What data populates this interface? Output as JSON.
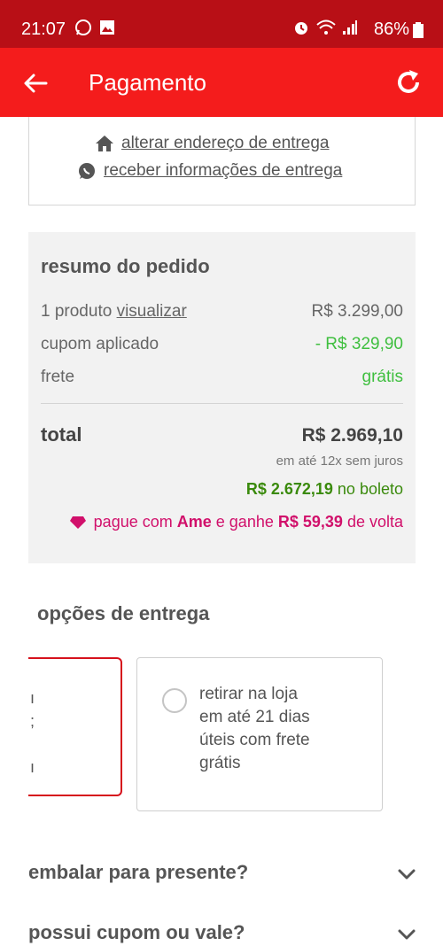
{
  "status_bar": {
    "time": "21:07",
    "battery": "86%",
    "icons": [
      "whatsapp-icon",
      "image-icon",
      "alarm-icon",
      "wifi-icon",
      "signal-icon",
      "battery-icon"
    ],
    "color": "#b80f16"
  },
  "app_bar": {
    "title": "Pagamento",
    "color": "#f41c1c"
  },
  "address": {
    "change_address": "alterar endereço de entrega",
    "receive_info": "receber informações de entrega"
  },
  "order_summary": {
    "heading": "resumo do pedido",
    "product_count": "1 produto",
    "view_link": "visualizar",
    "product_price": "R$ 3.299,00",
    "coupon_label": "cupom aplicado",
    "coupon_value": "- R$ 329,90",
    "shipping_label": "frete",
    "shipping_value": "grátis",
    "total_label": "total",
    "total_value": "R$ 2.969,10",
    "installments": "em até 12x sem juros",
    "boleto_value": "R$ 2.672,19",
    "boleto_suffix": "no boleto",
    "ame_prefix": "pague com",
    "ame_brand": "Ame",
    "ame_middle": "e ganhe",
    "ame_cashback": "R$ 59,39",
    "ame_suffix": "de volta"
  },
  "delivery": {
    "heading": "opções de entrega",
    "selected_fragment": [
      "ı",
      ";",
      "ı"
    ],
    "store_pickup": "retirar na loja em até 21 dias úteis com frete grátis"
  },
  "gift_wrap": {
    "question": "embalar para presente?"
  },
  "coupon": {
    "question": "possui cupom ou vale?"
  },
  "colors": {
    "brand_red": "#f41c1c",
    "discount_green": "#3fbf3f",
    "boleto_green": "#3a8a0c",
    "ame_pink": "#d1106b"
  }
}
